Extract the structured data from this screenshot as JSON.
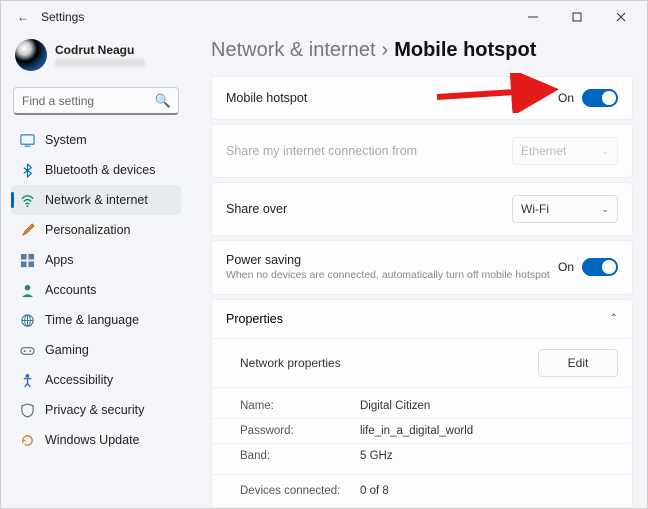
{
  "window": {
    "title": "Settings"
  },
  "user": {
    "name": "Codrut Neagu"
  },
  "search": {
    "placeholder": "Find a setting"
  },
  "sidebar": {
    "items": [
      {
        "label": "System"
      },
      {
        "label": "Bluetooth & devices"
      },
      {
        "label": "Network & internet"
      },
      {
        "label": "Personalization"
      },
      {
        "label": "Apps"
      },
      {
        "label": "Accounts"
      },
      {
        "label": "Time & language"
      },
      {
        "label": "Gaming"
      },
      {
        "label": "Accessibility"
      },
      {
        "label": "Privacy & security"
      },
      {
        "label": "Windows Update"
      }
    ]
  },
  "breadcrumb": {
    "parent": "Network & internet",
    "sep": "›",
    "current": "Mobile hotspot"
  },
  "rows": {
    "hotspot": {
      "label": "Mobile hotspot",
      "state": "On"
    },
    "sharefrom": {
      "label": "Share my internet connection from",
      "value": "Ethernet"
    },
    "shareover": {
      "label": "Share over",
      "value": "Wi-Fi"
    },
    "powersave": {
      "label": "Power saving",
      "sub": "When no devices are connected, automatically turn off mobile hotspot",
      "state": "On"
    }
  },
  "properties": {
    "title": "Properties",
    "nettitle": "Network properties",
    "edit": "Edit",
    "name_k": "Name:",
    "name_v": "Digital Citizen",
    "pass_k": "Password:",
    "pass_v": "life_in_a_digital_world",
    "band_k": "Band:",
    "band_v": "5 GHz",
    "dev_k": "Devices connected:",
    "dev_v": "0 of 8"
  }
}
